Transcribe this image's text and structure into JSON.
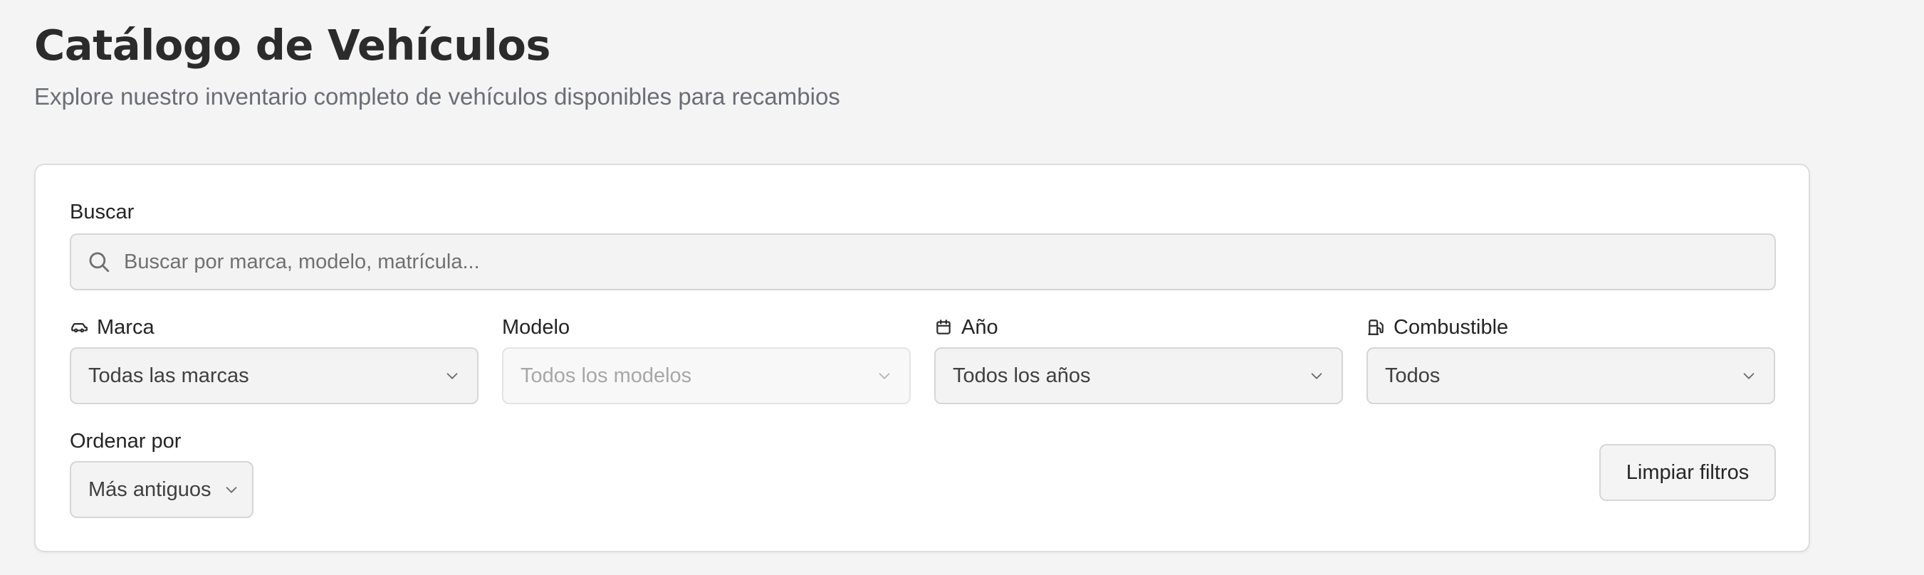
{
  "header": {
    "title": "Catálogo de Vehículos",
    "subtitle": "Explore nuestro inventario completo de vehículos disponibles para recambios"
  },
  "filters": {
    "search": {
      "label": "Buscar",
      "placeholder": "Buscar por marca, modelo, matrícula...",
      "value": "",
      "icon": "search-icon"
    },
    "brand": {
      "label": "Marca",
      "icon": "car-icon",
      "selected": "Todas las marcas"
    },
    "model": {
      "label": "Modelo",
      "selected": "Todos los modelos",
      "disabled": true
    },
    "year": {
      "label": "Año",
      "icon": "calendar-icon",
      "selected": "Todos los años"
    },
    "fuel": {
      "label": "Combustible",
      "icon": "fuel-pump-icon",
      "selected": "Todos"
    },
    "sort": {
      "label": "Ordenar por",
      "selected": "Más antiguos"
    },
    "clear_label": "Limpiar filtros"
  },
  "colors": {
    "background": "#f4f4f4",
    "card": "#ffffff",
    "field_background": "#f3f3f3",
    "border": "#d6d6d6",
    "title_text": "#2b2b2b",
    "muted_text": "#6a6e74",
    "disabled_text": "#a7a7a7"
  }
}
